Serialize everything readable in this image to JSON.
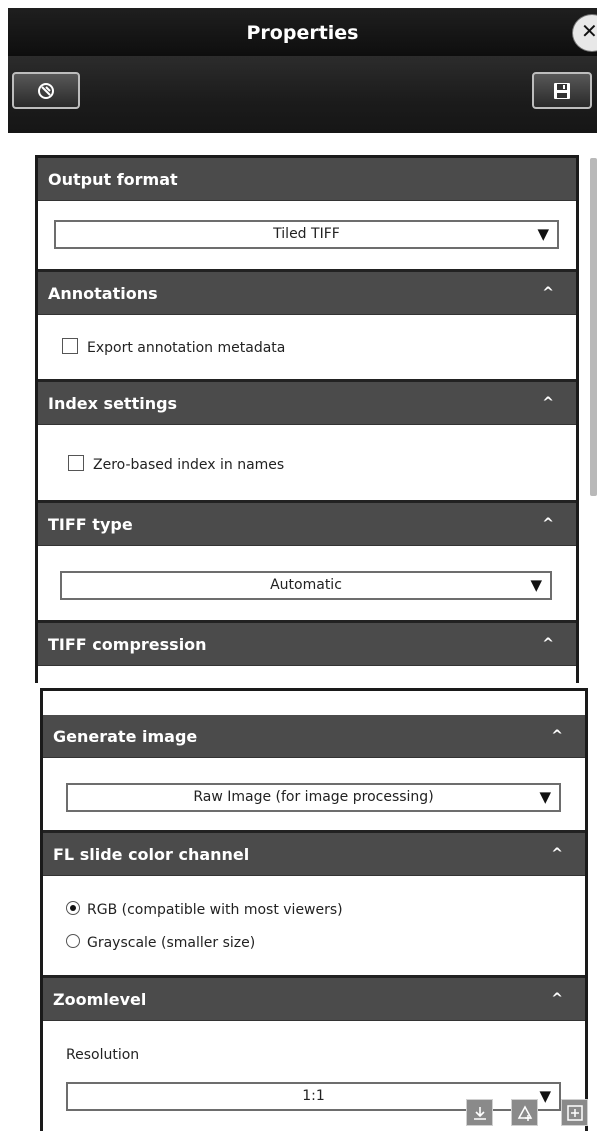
{
  "window": {
    "title": "Properties",
    "close_glyph": "✕"
  },
  "toolbar": {
    "reset_icon": "reset-circle-icon",
    "save_icon": "floppy-disk-icon"
  },
  "sections": {
    "output_format": {
      "header": "Output format",
      "value": "Tiled TIFF"
    },
    "annotations": {
      "header": "Annotations",
      "caret": "^",
      "checkbox_label": "Export annotation metadata",
      "checked": false
    },
    "index_settings": {
      "header": "Index settings",
      "caret": "^",
      "checkbox_label": "Zero-based index in names",
      "checked": false
    },
    "tiff_type": {
      "header": "TIFF type",
      "caret": "^",
      "value": "Automatic"
    },
    "tiff_compression": {
      "header": "TIFF compression",
      "caret": "^"
    },
    "generate_image": {
      "header": "Generate image",
      "caret": "^",
      "value": "Raw Image (for image processing)"
    },
    "fl_slide_color_channel": {
      "header": "FL slide color channel",
      "caret": "^",
      "options": [
        {
          "label": "RGB (compatible with most viewers)",
          "selected": true
        },
        {
          "label": "Grayscale (smaller size)",
          "selected": false
        }
      ]
    },
    "zoomlevel": {
      "header": "Zoomlevel",
      "caret": "^",
      "resolution_label": "Resolution",
      "value": "1:1"
    }
  },
  "dropdown_arrow": "▼",
  "floating_icons": [
    "download-icon",
    "add-annotation-icon",
    "add-region-icon"
  ],
  "colors": {
    "header_bg": "#4b4b4b",
    "titlebar_bg": "#151515"
  }
}
